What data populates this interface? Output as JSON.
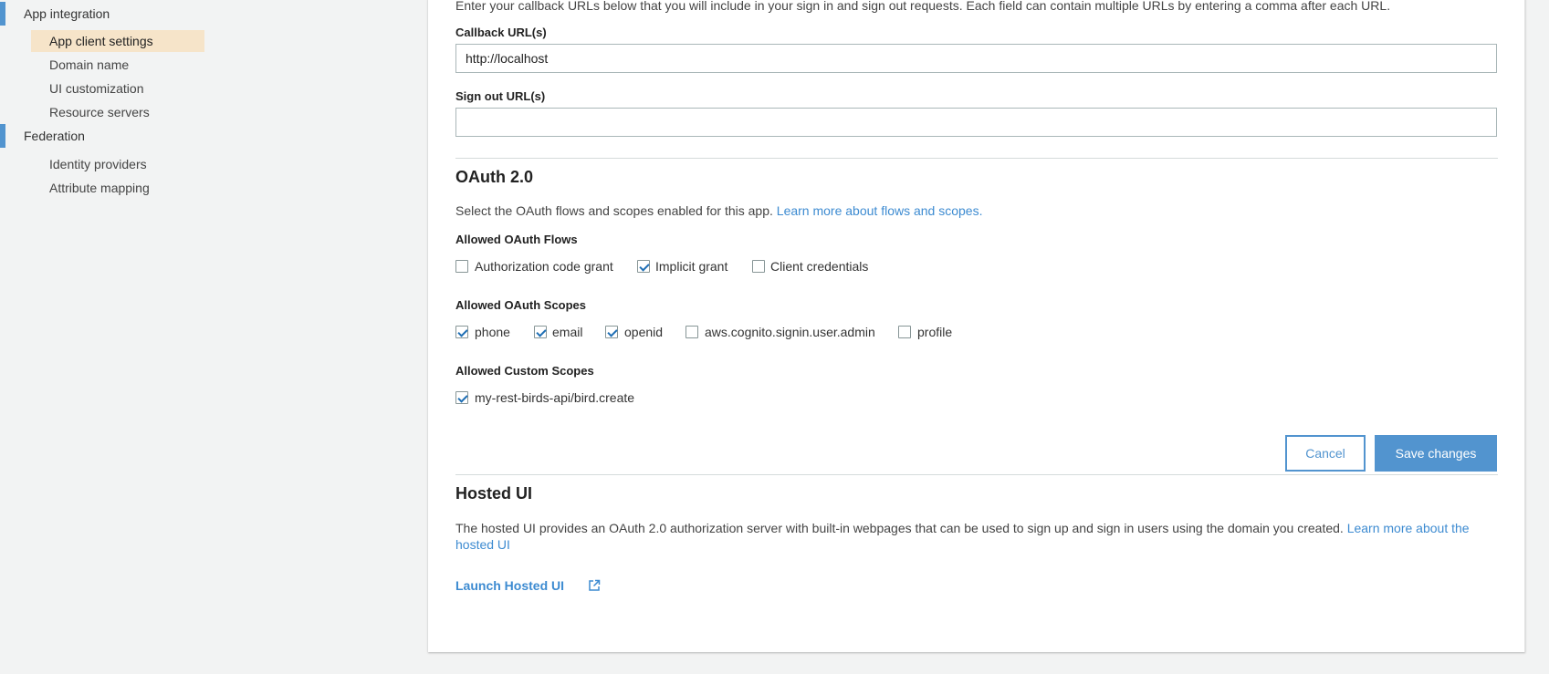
{
  "sidebar": {
    "sections": [
      {
        "label": "App integration",
        "items": [
          {
            "label": "App client settings",
            "active": true
          },
          {
            "label": "Domain name"
          },
          {
            "label": "UI customization"
          },
          {
            "label": "Resource servers"
          }
        ]
      },
      {
        "label": "Federation",
        "items": [
          {
            "label": "Identity providers"
          },
          {
            "label": "Attribute mapping"
          }
        ]
      }
    ]
  },
  "urls": {
    "intro": "Enter your callback URLs below that you will include in your sign in and sign out requests. Each field can contain multiple URLs by entering a comma after each URL.",
    "callback_label": "Callback URL(s)",
    "callback_value": "http://localhost",
    "signout_label": "Sign out URL(s)",
    "signout_value": ""
  },
  "oauth": {
    "title": "OAuth 2.0",
    "description": "Select the OAuth flows and scopes enabled for this app.",
    "learn_link": "Learn more about flows and scopes.",
    "flows_label": "Allowed OAuth Flows",
    "flows": [
      {
        "label": "Authorization code grant",
        "checked": false
      },
      {
        "label": "Implicit grant",
        "checked": true
      },
      {
        "label": "Client credentials",
        "checked": false
      }
    ],
    "scopes_label": "Allowed OAuth Scopes",
    "scopes": [
      {
        "label": "phone",
        "checked": true
      },
      {
        "label": "email",
        "checked": true
      },
      {
        "label": "openid",
        "checked": true
      },
      {
        "label": "aws.cognito.signin.user.admin",
        "checked": false
      },
      {
        "label": "profile",
        "checked": false
      }
    ],
    "custom_label": "Allowed Custom Scopes",
    "custom_scopes": [
      {
        "label": "my-rest-birds-api/bird.create",
        "checked": true
      }
    ]
  },
  "actions": {
    "cancel": "Cancel",
    "save": "Save changes"
  },
  "hosted": {
    "title": "Hosted UI",
    "description": "The hosted UI provides an OAuth 2.0 authorization server with built-in webpages that can be used to sign up and sign in users using the domain you created.",
    "learn_link_line1": "Learn more about the",
    "learn_link_line2": "hosted UI",
    "launch": "Launch Hosted UI"
  },
  "colors": {
    "accent": "#5294cf",
    "link": "#3d8bd1",
    "active_item_bg": "#f6e4c9",
    "page_bg": "#f2f3f3"
  }
}
